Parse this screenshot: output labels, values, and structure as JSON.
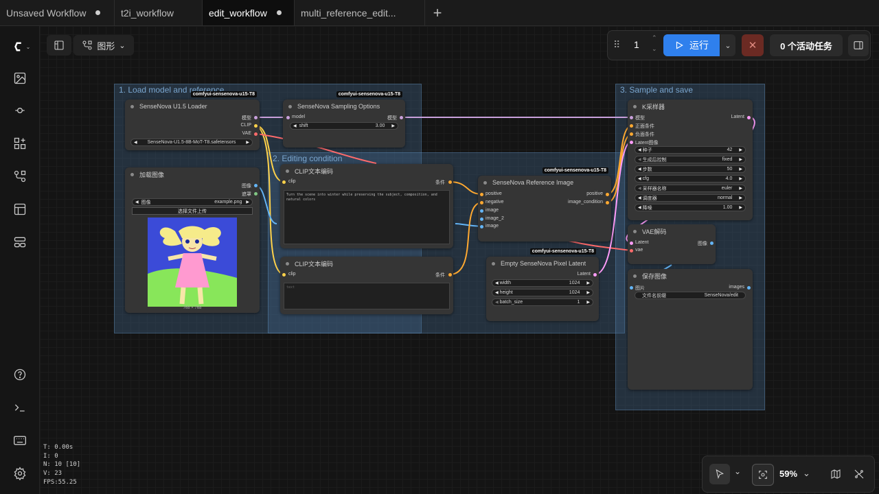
{
  "tabs": [
    {
      "label": "Unsaved Workflow",
      "modified": true
    },
    {
      "label": "t2i_workflow",
      "modified": false
    },
    {
      "label": "edit_workflow",
      "modified": true,
      "active": true
    },
    {
      "label": "multi_reference_edit...",
      "modified": false
    }
  ],
  "view_menu": {
    "label": "图形"
  },
  "run_controls": {
    "batch_count": "1",
    "run_label": "运行",
    "active_tasks": "0 个活动任务"
  },
  "groups": {
    "g1": "1. Load model and reference",
    "g2": "2. Editing condition",
    "g3": "3. Sample and save"
  },
  "badge": "comfyui-sensenova-u15-T8",
  "nodes": {
    "loader": {
      "title": "SenseNova U1.5 Loader",
      "outputs": [
        "模型",
        "CLIP",
        "VAE"
      ],
      "model_value": "SenseNova-U1.5-8B-MoT-T8.safetensors"
    },
    "sampling_options": {
      "title": "SenseNova Sampling Options",
      "input": "model",
      "output": "模型",
      "shift_label": "shift",
      "shift_value": "3.00"
    },
    "load_image": {
      "title": "加载图像",
      "outputs": [
        "图像",
        "遮罩"
      ],
      "image_label": "图像",
      "image_value": "example.png",
      "upload_label": "选择文件上传",
      "preview_size": "768 × 768"
    },
    "clip_pos": {
      "title": "CLIP文本编码",
      "input": "clip",
      "output": "条件",
      "text": "Turn the scene into winter while preserving the subject, composition, and natural colors"
    },
    "clip_neg": {
      "title": "CLIP文本编码",
      "input": "clip",
      "output": "条件",
      "placeholder": "text"
    },
    "ref_image": {
      "title": "SenseNova Reference Image",
      "inputs": [
        "positive",
        "negative",
        "image",
        "image_2",
        "image"
      ],
      "outputs": [
        "positive",
        "image_condition"
      ]
    },
    "empty_latent": {
      "title": "Empty SenseNova Pixel Latent",
      "output": "Latent",
      "widgets": [
        {
          "label": "width",
          "value": "1024"
        },
        {
          "label": "height",
          "value": "1024"
        },
        {
          "label": "batch_size",
          "value": "1"
        }
      ]
    },
    "ksampler": {
      "title": "K采样器",
      "inputs": [
        "模型",
        "正面条件",
        "负面条件",
        "Latent图像"
      ],
      "output": "Latent",
      "widgets": [
        {
          "label": "种子",
          "value": "42"
        },
        {
          "label": "生成后控制",
          "value": "fixed"
        },
        {
          "label": "步数",
          "value": "50"
        },
        {
          "label": "cfg",
          "value": "4.0"
        },
        {
          "label": "采样器名称",
          "value": "euler"
        },
        {
          "label": "调度器",
          "value": "normal"
        },
        {
          "label": "降噪",
          "value": "1.00"
        }
      ]
    },
    "vae_decode": {
      "title": "VAE解码",
      "inputs": [
        "Latent",
        "vae"
      ],
      "output": "图像"
    },
    "save_image": {
      "title": "保存图像",
      "input": "图片",
      "output": "images",
      "prefix_label": "文件名前缀",
      "prefix_value": "SenseNova/edit"
    }
  },
  "stats": [
    "T: 0.00s",
    "I: 0",
    "N: 10 [10]",
    "V: 23",
    "FPS:55.25"
  ],
  "zoom": "59%",
  "colors": {
    "run": "#2f80ed",
    "stop": "#6b2a23",
    "clip_link": "#ffd24a",
    "model_link": "#c9a0dc",
    "vae_link": "#ff6b6b",
    "image_link": "#64b5f6",
    "latent_link": "#ff9cf9",
    "cond_link": "#ffa931"
  }
}
